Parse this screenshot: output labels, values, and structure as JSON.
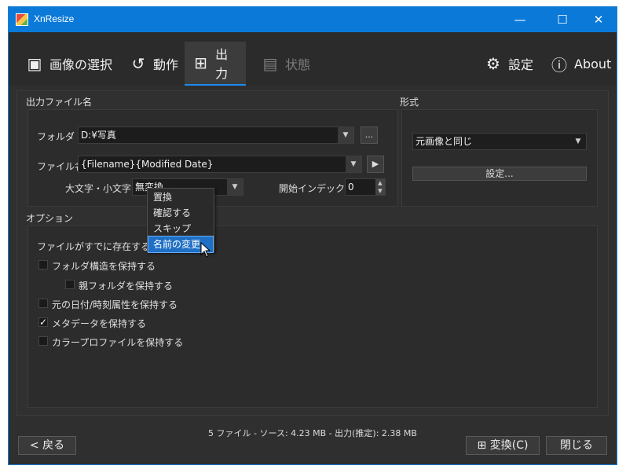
{
  "window": {
    "title": "XnResize",
    "minimize": "—",
    "maximize": "☐",
    "close": "✕"
  },
  "tabs": [
    {
      "label": "画像の選択",
      "icon": "image-select-icon",
      "glyph": "▣"
    },
    {
      "label": "動作",
      "icon": "action-icon",
      "glyph": "↺"
    },
    {
      "label": "出力",
      "icon": "output-icon",
      "glyph": "⊞"
    },
    {
      "label": "状態",
      "icon": "status-icon",
      "glyph": "▤"
    },
    {
      "label": "設定",
      "icon": "gear-icon",
      "glyph": "⚙"
    },
    {
      "label": "About",
      "icon": "info-icon",
      "glyph": "ⓘ"
    }
  ],
  "output": {
    "group_label": "出力ファイル名",
    "folder_label": "フォルダ",
    "folder_value": "D:¥写真",
    "browse_label": "...",
    "filename_label": "ファイル名",
    "filename_value": "{Filename}{Modified Date}",
    "filename_menu_glyph": "▶",
    "case_label": "大文字・小文字",
    "case_value": "無変換",
    "start_index_label": "開始インデックス",
    "start_index_value": "0"
  },
  "format": {
    "group_label": "形式",
    "value": "元画像と同じ",
    "settings_label": "設定..."
  },
  "options": {
    "group_label": "オプション",
    "exists_label": "ファイルがすでに存在するとき",
    "exists_menu": [
      "置換",
      "確認する",
      "スキップ",
      "名前の変更"
    ],
    "exists_selected": "名前の変更",
    "checkboxes": [
      {
        "label": "フォルダ構造を保持する",
        "checked": false
      },
      {
        "label": "親フォルダを保持する",
        "checked": false
      },
      {
        "label": "元の日付/時刻属性を保持する",
        "checked": false
      },
      {
        "label": "メタデータを保持する",
        "checked": true
      },
      {
        "label": "カラープロファイルを保持する",
        "checked": false
      }
    ],
    "check_glyph": "✓"
  },
  "status_text": "5 ファイル - ソース: 4.23 MB - 出力(推定): 2.38 MB",
  "buttons": {
    "back": "< 戻る",
    "convert": "変換(C)",
    "close": "閉じる"
  },
  "colors": {
    "accent": "#0a79d8",
    "background": "#2f2f2f",
    "highlight": "#1f6fc4"
  }
}
